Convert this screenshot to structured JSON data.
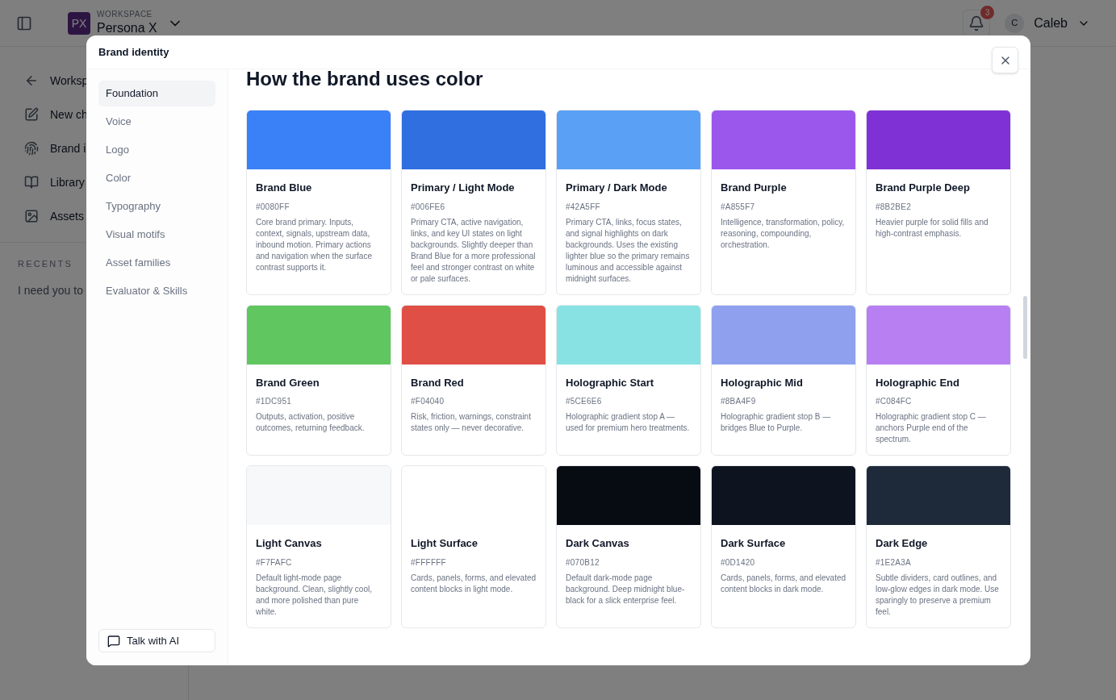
{
  "topbar": {
    "workspace_avatar": "PX",
    "workspace_label": "WORKSPACE",
    "workspace_name": "Persona X",
    "notification_count": "3",
    "user_avatar": "C",
    "user_name": "Caleb"
  },
  "sidebar": {
    "items": [
      {
        "label": "Worksp",
        "kind": "back"
      },
      {
        "label": "New ch",
        "kind": "edit"
      },
      {
        "label": "Brand i",
        "kind": "fingerprint"
      },
      {
        "label": "Library",
        "kind": "book"
      },
      {
        "label": "Assets",
        "kind": "image"
      }
    ],
    "recents_title": "RECENTS",
    "recents": [
      "I need you to"
    ]
  },
  "dialog": {
    "title": "Brand identity",
    "nav": [
      {
        "label": "Foundation",
        "selected": true
      },
      {
        "label": "Voice",
        "selected": false
      },
      {
        "label": "Logo",
        "selected": false
      },
      {
        "label": "Color",
        "selected": false
      },
      {
        "label": "Typography",
        "selected": false
      },
      {
        "label": "Visual motifs",
        "selected": false
      },
      {
        "label": "Asset families",
        "selected": false
      },
      {
        "label": "Evaluator & Skills",
        "selected": false
      }
    ],
    "talk_button": "Talk with AI",
    "heading": "How the brand uses color",
    "swatches": [
      {
        "name": "Brand Blue",
        "hex": "#0080FF",
        "color": "#3a80f6",
        "description": "Core brand primary. Inputs, context, signals, upstream data, inbound motion. Primary actions and navigation when the surface contrast supports it."
      },
      {
        "name": "Primary / Light Mode",
        "hex": "#006FE6",
        "color": "#2f6fe0",
        "description": "Primary CTA, active navigation, links, and key UI states on light backgrounds. Slightly deeper than Brand Blue for a more professional feel and stronger contrast on white or pale surfaces."
      },
      {
        "name": "Primary / Dark Mode",
        "hex": "#42A5FF",
        "color": "#5aa0f5",
        "description": "Primary CTA, links, focus states, and signal highlights on dark backgrounds. Uses the existing lighter blue so the primary remains luminous and accessible against midnight surfaces."
      },
      {
        "name": "Brand Purple",
        "hex": "#A855F7",
        "color": "#9b57ec",
        "description": "Intelligence, transformation, policy, reasoning, compounding, orchestration."
      },
      {
        "name": "Brand Purple Deep",
        "hex": "#8B2BE2",
        "color": "#8031d6",
        "description": "Heavier purple for solid fills and high-contrast emphasis."
      },
      {
        "name": "Brand Green",
        "hex": "#1DC951",
        "color": "#60c660",
        "description": "Outputs, activation, positive outcomes, returning feedback."
      },
      {
        "name": "Brand Red",
        "hex": "#F04040",
        "color": "#e04f45",
        "description": "Risk, friction, warnings, constraint states only — never decorative."
      },
      {
        "name": "Holographic Start",
        "hex": "#5CE6E6",
        "color": "#88e2e3",
        "description": "Holographic gradient stop A — used for premium hero treatments."
      },
      {
        "name": "Holographic Mid",
        "hex": "#8BA4F9",
        "color": "#8ea0ee",
        "description": "Holographic gradient stop B — bridges Blue to Purple."
      },
      {
        "name": "Holographic End",
        "hex": "#C084FC",
        "color": "#b87ff2",
        "description": "Holographic gradient stop C — anchors Purple end of the spectrum."
      },
      {
        "name": "Light Canvas",
        "hex": "#F7FAFC",
        "color": "#f7f8fa",
        "description": "Default light-mode page background. Clean, slightly cool, and more polished than pure white."
      },
      {
        "name": "Light Surface",
        "hex": "#FFFFFF",
        "color": "#ffffff",
        "description": "Cards, panels, forms, and elevated content blocks in light mode."
      },
      {
        "name": "Dark Canvas",
        "hex": "#070B12",
        "color": "#070b12",
        "description": "Default dark-mode page background. Deep midnight blue-black for a slick enterprise feel."
      },
      {
        "name": "Dark Surface",
        "hex": "#0D1420",
        "color": "#0d1420",
        "description": "Cards, panels, forms, and elevated content blocks in dark mode."
      },
      {
        "name": "Dark Edge",
        "hex": "#1E2A3A",
        "color": "#1e2a3a",
        "description": "Subtle dividers, card outlines, and low-glow edges in dark mode. Use sparingly to preserve a premium feel."
      }
    ]
  }
}
